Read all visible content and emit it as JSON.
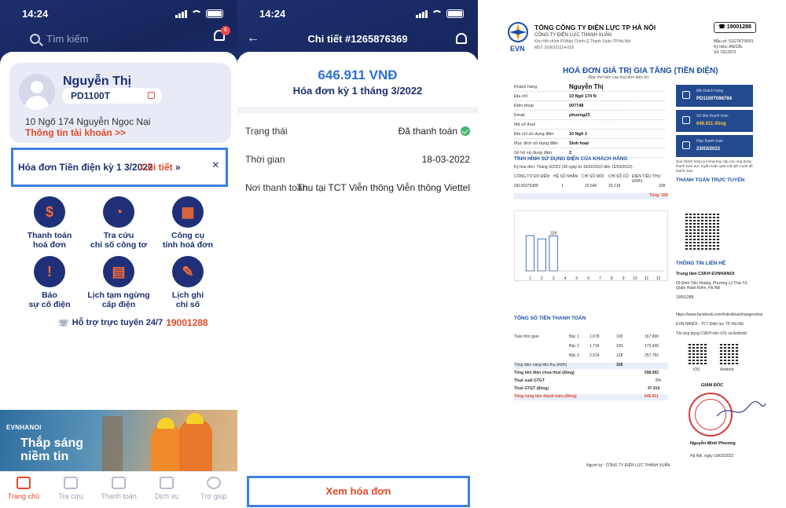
{
  "status": {
    "time1": "14:24",
    "time2": "14:24"
  },
  "home": {
    "search_placeholder": "Tìm kiếm",
    "notif_count": "6",
    "account": {
      "name": "Nguyễn Thị",
      "code": "PD1100T",
      "address": "10 Ngõ 174 Nguyễn Ngọc Nại",
      "link": "Thông tin tài khoản >>"
    },
    "bill_banner": {
      "text": "Hóa đơn Tiền điện kỳ 1 3/2022",
      "link": "Chi tiết",
      "arrows": "»",
      "close": "×"
    },
    "services": [
      {
        "label1": "Thanh toán",
        "label2": "hoá đơn",
        "glyph": "$"
      },
      {
        "label1": "Tra cứu",
        "label2": "chỉ số công tơ",
        "glyph": "◔"
      },
      {
        "label1": "Công cụ",
        "label2": "tính hoá đơn",
        "glyph": "▦"
      },
      {
        "label1": "Báo",
        "label2": "sự cố điện",
        "glyph": "!"
      },
      {
        "label1": "Lịch tạm ngừng",
        "label2": "cấp điện",
        "glyph": "▤"
      },
      {
        "label1": "Lịch ghi",
        "label2": "chỉ số",
        "glyph": "✎"
      }
    ],
    "hotline": {
      "label": "Hỗ trợ trực tuyến 24/7",
      "number": "19001288"
    },
    "promo": {
      "brand": "EVNHANOI",
      "slogan1": "Thắp sáng",
      "slogan2": "niềm tin"
    },
    "tabs": [
      "Trang chủ",
      "Tra cứu",
      "Thanh toán",
      "Dịch vụ",
      "Trợ giúp"
    ]
  },
  "detail": {
    "title": "Chi tiết #1265876369",
    "amount": "646.911 VNĐ",
    "period": "Hóa đơn kỳ 1 tháng 3/2022",
    "rows": [
      {
        "label": "Trạng thái",
        "value": "Đã thanh toán"
      },
      {
        "label": "Thời gian",
        "value": "18-03-2022"
      },
      {
        "label": "Nơi thanh toán",
        "value": "Thu tại TCT Viễn thông Viễn thông Viettel"
      }
    ],
    "view_button": "Xem hóa đơn"
  },
  "invoice": {
    "logo": "EVN",
    "org1": "TỔNG CÔNG TY ĐIỆN LỰC TP HÀ NỘI",
    "org2": "CÔNG TY ĐIỆN LỰC THANH XUÂN",
    "org3": "Khu Hội chính-P.Nhân Chính-Q.Thanh Xuân-TP.Hà Nội",
    "org4": "MST: 0100101114-018",
    "phone": "19001288",
    "meta": [
      "Mẫu số: 01GTKT0/001",
      "Ký hiệu: AN/22E",
      "Số: 0312973"
    ],
    "title": "HOÁ ĐƠN GIÁ TRỊ GIA TĂNG (TIỀN ĐIỆN)",
    "subtitle": "(Bản thể hiện của hoá đơn điện tử)",
    "fields": [
      {
        "k": "Khách hàng",
        "v": "Nguyễn Thị"
      },
      {
        "k": "Địa chỉ",
        "v": "10 Ngõ 174 N"
      },
      {
        "k": "Điện thoại",
        "v": "007748"
      },
      {
        "k": "Email",
        "v": "phuong23"
      },
      {
        "k": "Mã số thuế",
        "v": ""
      },
      {
        "k": "Địa chỉ sử dụng điện",
        "v": "10 Ngõ 1"
      },
      {
        "k": "Mục đích sử dụng điện",
        "v": "Sinh hoạt"
      },
      {
        "k": "Số hộ sử dụng điện",
        "v": "2"
      }
    ],
    "cards": [
      {
        "label": "Mã khách hàng",
        "value": "PD1100T096784"
      },
      {
        "label": "Số tiền thanh toán",
        "value": "646.911 đồng"
      },
      {
        "label": "Hạn thanh toán",
        "value": "23/03/2022"
      }
    ],
    "sec_usage": "TÌNH HÌNH SỬ DỤNG ĐIỆN CỦA KHÁCH HÀNG",
    "usage_period": "Kỳ hóa đơn: Tháng 3/2022 (28 ngày từ 16/02/2022 đến 15/03/2022)",
    "usage_head": [
      "CÔNG TƠ ĐO ĐẾM",
      "HỆ SỐ NHÂN",
      "CHỈ SỐ MỚI",
      "CHỈ SỐ CŨ",
      "ĐIỆN TIÊU THỤ (kWh)"
    ],
    "usage_row": [
      "18126079389",
      "1",
      "20.546",
      "20.218",
      "328"
    ],
    "usage_total": "Tổng: 328",
    "sec_online": "THANH TOÁN TRỰC TUYẾN",
    "online_note": "Quý khách hàng vui lòng truy cập các ứng dụng thanh toán trực tuyến hoặc quét mã QR Code để thanh toán",
    "sec_contact": "THÔNG TIN LIÊN HỆ",
    "contact": [
      "Trung tâm CSKH EVNHANOI",
      "69 Đinh Tiên Hoàng, Phường Lý Thái Tổ, Quận Hoàn Kiếm, Hà Nội",
      "19001288",
      "https://www.facebook.com/hotrokhachhangevnhanoi",
      "EVN HANOI - TCT Điện lực TP Hà Nội",
      "Tải ứng dụng CSKH trên iOS và Android"
    ],
    "sec_pay": "TỔNG SỐ TIỀN THANH TOÁN",
    "pay_rows": [
      {
        "a": "Toàn thời gian",
        "b": "Bậc 1",
        "c": "1.678",
        "d": "100",
        "e": "167.800"
      },
      {
        "a": "",
        "b": "Bậc 2",
        "c": "1.734",
        "d": "100",
        "e": "173.400"
      },
      {
        "a": "",
        "b": "Bậc 3",
        "c": "2.014",
        "d": "128",
        "e": "257.792"
      }
    ],
    "totals": [
      {
        "k": "Tổng điện năng tiêu thụ (kWh)",
        "v": "328"
      },
      {
        "k": "Tổng tiền điện chưa thuế (đồng)",
        "v": "598.992"
      },
      {
        "k": "Thuế suất GTGT",
        "v": "8%"
      },
      {
        "k": "Thuế GTGT (đồng)",
        "v": "47.919"
      },
      {
        "k": "Tổng cộng tiền thanh toán (đồng)",
        "v": "646.911"
      }
    ],
    "director": "GIÁM ĐỐC",
    "signer": "Nguyễn Minh Phương",
    "place_date": "Hà Nội, ngày 18/03/2022",
    "seller": "Người ký : CÔNG TY ĐIỆN LỰC THANH XUÂN",
    "qr_labels": [
      "iOS",
      "Android"
    ]
  },
  "chart_data": {
    "type": "bar",
    "categories": [
      "1",
      "2",
      "3",
      "4",
      "5",
      "6",
      "7",
      "8",
      "9",
      "10",
      "11",
      "12"
    ],
    "values": [
      330,
      300,
      328,
      null,
      null,
      null,
      null,
      null,
      null,
      null,
      null,
      null
    ],
    "data_labels": [
      "",
      "",
      "328"
    ],
    "ylim": [
      0,
      500
    ]
  },
  "colors": {
    "navy": "#1d2f6e",
    "accent": "#e24a2a",
    "blue": "#2d6fd2",
    "highlight": "#3f7fe0",
    "green": "#3fb46c"
  }
}
